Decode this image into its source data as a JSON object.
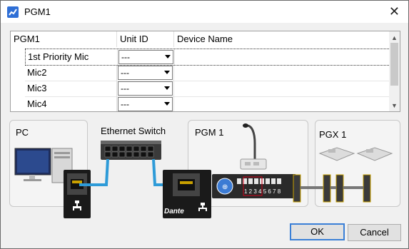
{
  "window": {
    "title": "PGM1",
    "close_glyph": "✕"
  },
  "list": {
    "columns": [
      "PGM1",
      "Unit ID",
      "Device Name"
    ],
    "rows": [
      {
        "name": "1st Priority Mic",
        "unit_id": "---"
      },
      {
        "name": "Mic2",
        "unit_id": "---"
      },
      {
        "name": "Mic3",
        "unit_id": "---"
      },
      {
        "name": "Mic4",
        "unit_id": "---"
      }
    ]
  },
  "diagram": {
    "pc_label": "PC",
    "switch_label": "Ethernet Switch",
    "pgm_label": "PGM 1",
    "pgx_label": "PGX 1",
    "dante_label": "Dante",
    "dip_numbers": "1 2 3 4 5 6 7 8"
  },
  "buttons": {
    "ok": "OK",
    "cancel": "Cancel"
  },
  "colors": {
    "cable": "#2e9bd8",
    "accent": "#3a7fd6",
    "dip_highlight": "#d0021b"
  }
}
